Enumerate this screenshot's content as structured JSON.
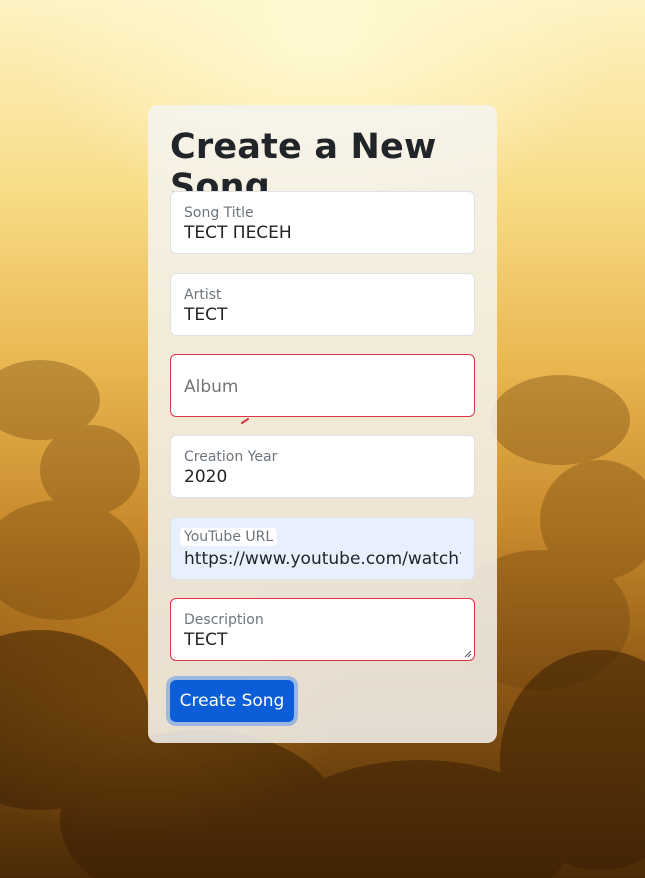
{
  "form": {
    "title": "Create a New Song",
    "fields": {
      "song_title": {
        "label": "Song Title",
        "value": "ТЕСТ ПЕСЕН"
      },
      "artist": {
        "label": "Artist",
        "value": "ТЕСТ"
      },
      "album": {
        "label": "Album",
        "value": "",
        "placeholder": "Album"
      },
      "creation_year": {
        "label": "Creation Year",
        "value": "2020"
      },
      "youtube_url": {
        "label": "YouTube URL",
        "value": "https://www.youtube.com/watch?v="
      },
      "description": {
        "label": "Description",
        "value": "ТЕСТ"
      }
    },
    "submit_label": "Create Song"
  },
  "colors": {
    "primary": "#0b5ed7",
    "invalid_border": "#dc3545",
    "autofill_bg": "#e8f0fe"
  }
}
